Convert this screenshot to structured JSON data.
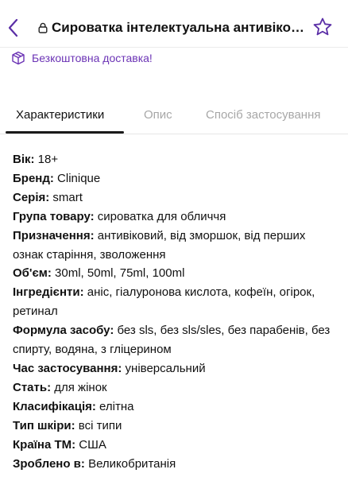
{
  "header": {
    "title": "Сироватка інтелектуальна антивіковий"
  },
  "delivery": {
    "text": "Безкоштовна доставка!"
  },
  "tabs": [
    {
      "label": "Характеристики",
      "active": true
    },
    {
      "label": "Опис",
      "active": false
    },
    {
      "label": "Спосіб застосування",
      "active": false
    }
  ],
  "specs": [
    {
      "label": "Вік:",
      "value": " 18+"
    },
    {
      "label": "Бренд:",
      "value": " Clinique"
    },
    {
      "label": "Серія:",
      "value": " smart"
    },
    {
      "label": "Група товару:",
      "value": " сироватка для обличчя"
    },
    {
      "label": "Призначення:",
      "value": " антивіковий, від зморшок, від перших ознак старіння, зволоження"
    },
    {
      "label": "Об'єм:",
      "value": " 30ml, 50ml, 75ml, 100ml"
    },
    {
      "label": "Інгредієнти:",
      "value": " аніс, гіалуронова кислота, кофеїн, огірок, ретинал"
    },
    {
      "label": "Формула засобу:",
      "value": " без sls, без sls/sles, без парабенів, без спирту, водяна, з гліцерином"
    },
    {
      "label": "Час застосування:",
      "value": " універсальний"
    },
    {
      "label": "Стать:",
      "value": " для жінок"
    },
    {
      "label": "Класифікація:",
      "value": " елітна"
    },
    {
      "label": "Тип шкіри:",
      "value": " всі типи"
    },
    {
      "label": "Країна ТМ:",
      "value": " США"
    },
    {
      "label": "Зроблено в:",
      "value": " Великобританія"
    }
  ],
  "colors": {
    "accent": "#6b33b5",
    "text": "#111111",
    "muted": "#a7a7a7"
  }
}
